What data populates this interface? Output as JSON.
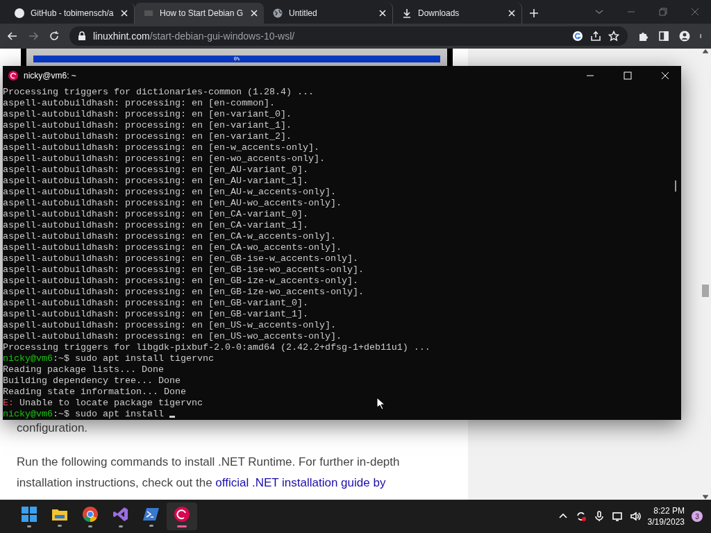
{
  "browser": {
    "tabs": [
      {
        "title": "GitHub - tobimensch/a",
        "selected": false
      },
      {
        "title": "How to Start Debian G",
        "selected": true
      },
      {
        "title": "Untitled",
        "selected": false
      },
      {
        "title": "Downloads",
        "selected": false
      }
    ],
    "address": {
      "host": "linuxhint.com",
      "path": "/start-debian-gui-windows-10-wsl/"
    }
  },
  "page": {
    "progress": {
      "label": "0%",
      "level": 1
    },
    "configuration_text": "configuration.",
    "paragraph": "Run the following commands to install .NET Runtime. For further in-depth installation instructions, check out the ",
    "link": "official .NET installation guide by"
  },
  "terminal": {
    "title": "nicky@vm6: ~",
    "lines": [
      {
        "kind": "plain",
        "text": "Processing triggers for dictionaries-common (1.28.4) ..."
      },
      {
        "kind": "plain",
        "text": "aspell-autobuildhash: processing: en [en-common]."
      },
      {
        "kind": "plain",
        "text": "aspell-autobuildhash: processing: en [en-variant_0]."
      },
      {
        "kind": "plain",
        "text": "aspell-autobuildhash: processing: en [en-variant_1]."
      },
      {
        "kind": "plain",
        "text": "aspell-autobuildhash: processing: en [en-variant_2]."
      },
      {
        "kind": "plain",
        "text": "aspell-autobuildhash: processing: en [en-w_accents-only]."
      },
      {
        "kind": "plain",
        "text": "aspell-autobuildhash: processing: en [en-wo_accents-only]."
      },
      {
        "kind": "plain",
        "text": "aspell-autobuildhash: processing: en [en_AU-variant_0]."
      },
      {
        "kind": "plain",
        "text": "aspell-autobuildhash: processing: en [en_AU-variant_1]."
      },
      {
        "kind": "plain",
        "text": "aspell-autobuildhash: processing: en [en_AU-w_accents-only]."
      },
      {
        "kind": "plain",
        "text": "aspell-autobuildhash: processing: en [en_AU-wo_accents-only]."
      },
      {
        "kind": "plain",
        "text": "aspell-autobuildhash: processing: en [en_CA-variant_0]."
      },
      {
        "kind": "plain",
        "text": "aspell-autobuildhash: processing: en [en_CA-variant_1]."
      },
      {
        "kind": "plain",
        "text": "aspell-autobuildhash: processing: en [en_CA-w_accents-only]."
      },
      {
        "kind": "plain",
        "text": "aspell-autobuildhash: processing: en [en_CA-wo_accents-only]."
      },
      {
        "kind": "plain",
        "text": "aspell-autobuildhash: processing: en [en_GB-ise-w_accents-only]."
      },
      {
        "kind": "plain",
        "text": "aspell-autobuildhash: processing: en [en_GB-ise-wo_accents-only]."
      },
      {
        "kind": "plain",
        "text": "aspell-autobuildhash: processing: en [en_GB-ize-w_accents-only]."
      },
      {
        "kind": "plain",
        "text": "aspell-autobuildhash: processing: en [en_GB-ize-wo_accents-only]."
      },
      {
        "kind": "plain",
        "text": "aspell-autobuildhash: processing: en [en_GB-variant_0]."
      },
      {
        "kind": "plain",
        "text": "aspell-autobuildhash: processing: en [en_GB-variant_1]."
      },
      {
        "kind": "plain",
        "text": "aspell-autobuildhash: processing: en [en_US-w_accents-only]."
      },
      {
        "kind": "plain",
        "text": "aspell-autobuildhash: processing: en [en_US-wo_accents-only]."
      },
      {
        "kind": "plain",
        "text": "Processing triggers for libgdk-pixbuf-2.0-0:amd64 (2.42.2+dfsg-1+deb11u1) ..."
      },
      {
        "kind": "prompt",
        "prompt": "nicky@vm6",
        "text": ":~$ sudo apt install tigervnc"
      },
      {
        "kind": "plain",
        "text": "Reading package lists... Done"
      },
      {
        "kind": "plain",
        "text": "Building dependency tree... Done"
      },
      {
        "kind": "plain",
        "text": "Reading state information... Done"
      },
      {
        "kind": "error",
        "prefix": "E:",
        "text": " Unable to locate package tigervnc"
      },
      {
        "kind": "prompt",
        "prompt": "nicky@vm6",
        "text": ":~$ sudo apt install ",
        "cursor": true
      }
    ]
  },
  "taskbar": {
    "apps": [
      {
        "active": false
      },
      {
        "active": false
      },
      {
        "active": false
      },
      {
        "active": false
      },
      {
        "active": false
      },
      {
        "active": true
      }
    ],
    "time": "8:22 PM",
    "date": "3/19/2023",
    "notifications": "3"
  }
}
